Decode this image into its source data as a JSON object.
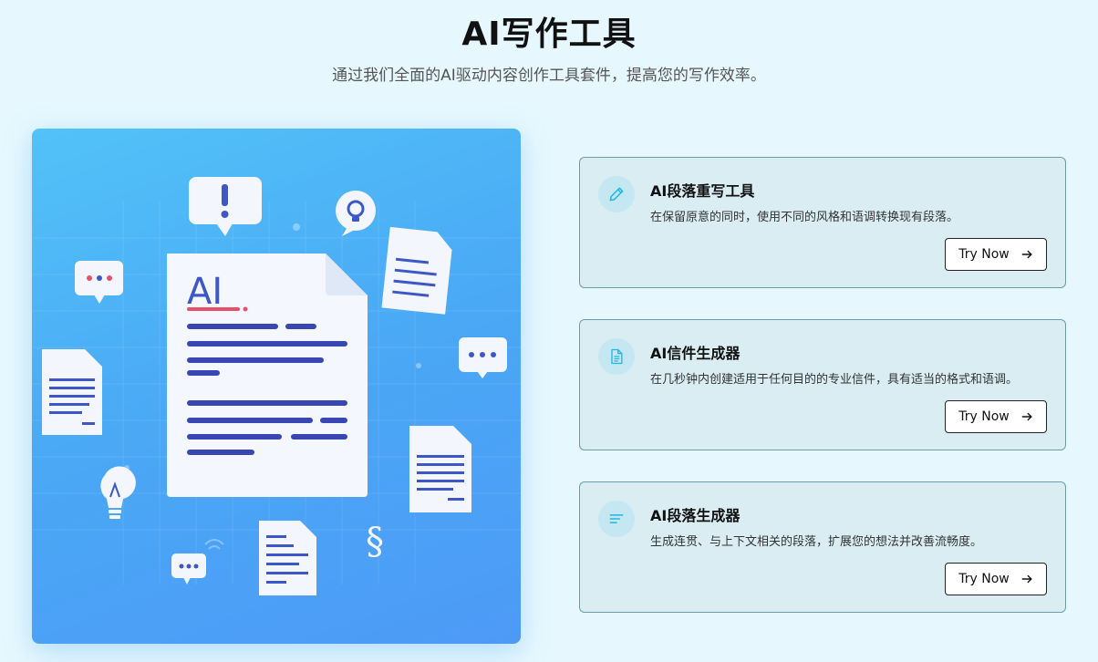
{
  "header": {
    "title": "AI写作工具",
    "subtitle": "通过我们全面的AI驱动内容创作工具套件，提高您的写作效率。"
  },
  "hero": {
    "doc_text": "AI",
    "icons": [
      "alert-bubble-icon",
      "lightbulb-bubble-icon",
      "chat-bubble-icon",
      "document-icon",
      "lightbulb-icon",
      "section-sign-icon",
      "wifi-icon"
    ]
  },
  "colors": {
    "accent": "#1fb7e6",
    "background": "#e6f8fe",
    "card_bg": "#d9edf2",
    "card_border": "#6d9bab"
  },
  "tools": [
    {
      "icon": "pencil-icon",
      "title": "AI段落重写工具",
      "description": "在保留原意的同时，使用不同的风格和语调转换现有段落。",
      "button": "Try Now"
    },
    {
      "icon": "document-icon",
      "title": "AI信件生成器",
      "description": "在几秒钟内创建适用于任何目的的专业信件，具有适当的格式和语调。",
      "button": "Try Now"
    },
    {
      "icon": "text-align-icon",
      "title": "AI段落生成器",
      "description": "生成连贯、与上下文相关的段落，扩展您的想法并改善流畅度。",
      "button": "Try Now"
    }
  ]
}
